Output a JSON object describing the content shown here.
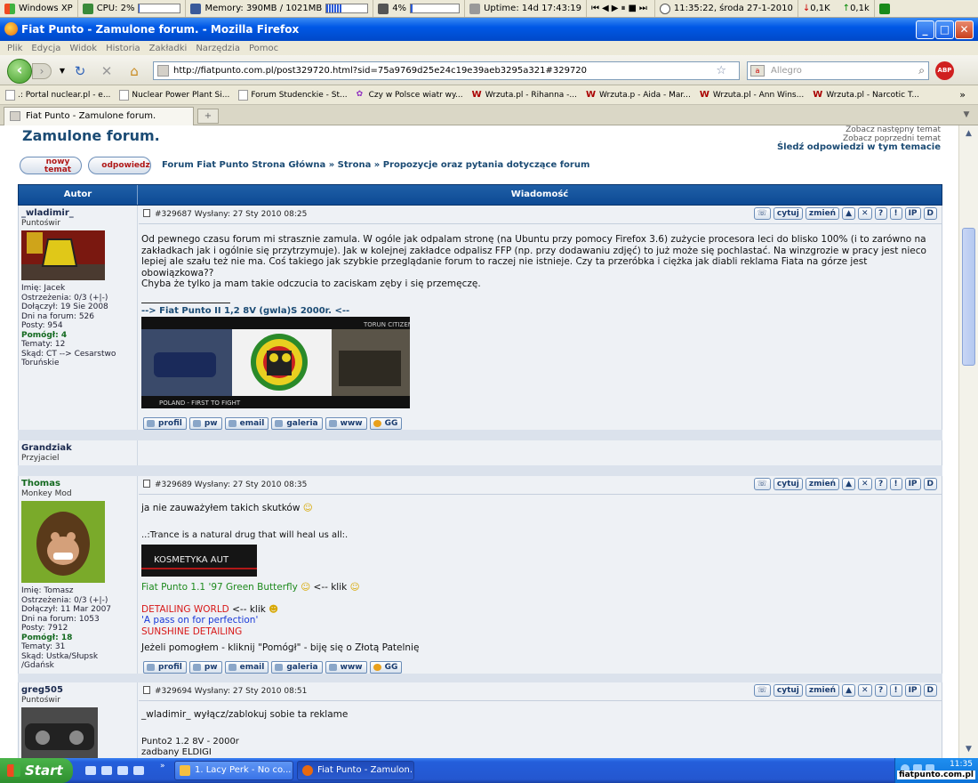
{
  "sysbar": {
    "os": "Windows XP",
    "cpu": "CPU: 2%",
    "cpu_level": 0.02,
    "memory": "Memory: 390MB / 1021MB",
    "memory_level": 0.38,
    "volume": "4%",
    "volume_level": 0.04,
    "uptime": "Uptime: 14d 17:43:19",
    "clock": "11:35:22, środa 27-1-2010",
    "down": "0,1K",
    "up": "0,1k"
  },
  "window": {
    "title": "Fiat Punto - Zamulone forum. - Mozilla Firefox",
    "minimize": "_",
    "maximize": "□",
    "close": "✕"
  },
  "menu": [
    "Plik",
    "Edycja",
    "Widok",
    "Historia",
    "Zakładki",
    "Narzędzia",
    "Pomoc"
  ],
  "nav": {
    "url": "http://fiatpunto.com.pl/post329720.html?sid=75a9769d25e24c19e39aeb3295a321#329720",
    "search_placeholder": "Allegro",
    "adblock": "ABP"
  },
  "bookmarks": [
    {
      "label": ".: Portal nuclear.pl - e...",
      "wrzuta": false
    },
    {
      "label": "Nuclear Power Plant Si...",
      "wrzuta": false
    },
    {
      "label": "Forum Studenckie - St...",
      "wrzuta": false
    },
    {
      "label": "Czy w Polsce wiatr wy...",
      "wrzuta": false
    },
    {
      "label": "Wrzuta.pl - Rihanna -...",
      "wrzuta": true
    },
    {
      "label": "Wrzuta.p - Aida - Mar...",
      "wrzuta": true
    },
    {
      "label": "Wrzuta.pl - Ann Wins...",
      "wrzuta": true
    },
    {
      "label": "Wrzuta.pl - Narcotic T...",
      "wrzuta": true
    }
  ],
  "tab": {
    "label": "Fiat Punto - Zamulone forum.",
    "new_tab": "+"
  },
  "page": {
    "title": "Zamulone forum.",
    "next_topic": "Zobacz następny temat",
    "prev_topic": "Zobacz poprzedni temat",
    "watch": "Śledź odpowiedzi w tym temacie",
    "new_topic_btn": "nowy temat",
    "reply_btn": "odpowiedz",
    "breadcrumb": "Forum Fiat Punto Strona Główna » Strona » Propozycje oraz pytania dotyczące forum",
    "col_author": "Autor",
    "col_message": "Wiadomość"
  },
  "post_buttons": {
    "quote": "cytuj",
    "edit": "zmień",
    "ip": "IP",
    "d": "D"
  },
  "footer_buttons": [
    "profil",
    "pw",
    "email",
    "galeria",
    "www",
    "GG"
  ],
  "posts": [
    {
      "author": "_wladimir_",
      "rank": "Puntoświr",
      "stats": [
        "Imię: Jacek",
        "Ostrzeżenia: 0/3 (+|-)",
        "Dołączył: 19 Sie 2008",
        "Dni na forum: 526",
        "Posty: 954",
        "Pomógł: 4",
        "Tematy: 12",
        "Skąd: CT --> Cesarstwo",
        "Toruńskie"
      ],
      "meta": "#329687 Wysłany: 27 Sty 2010 08:25",
      "body": "Od pewnego czasu forum mi strasznie zamula. W ogóle jak odpalam stronę (na Ubuntu przy pomocy Firefox 3.6) zużycie procesora leci do blisko 100% (i to zarówno na zakładkach jak i ogólnie się przytrzymuje). Jak w kolejnej zakładce odpalisz FFP (np. przy dodawaniu zdjęć) to już może się pochlastać. Na winzgrozie w pracy jest nieco lepiej ale szału też nie ma. Coś takiego jak szybkie przeglądanie forum to raczej nie istnieje. Czy ta przeróbka i ciężka jak diabli reklama Fiata na górze jest obowiązkowa??",
      "body2": "Chyba że tylko ja mam takie odczucia to zaciskam zęby i się przemęczę.",
      "sig": "--> Fiat Punto II 1,2 8V (gwla)S 2000r. <--",
      "banner_top": "TORUN CITIZEN",
      "banner_bottom": "POLAND - FIRST TO FIGHT"
    },
    {
      "author": "Grandziak",
      "rank": "Przyjaciel"
    },
    {
      "author": "Thomas",
      "rank": "Monkey Mod",
      "stats": [
        "Imię: Tomasz",
        "Ostrzeżenia: 0/3 (+|-)",
        "Dołączył: 11 Mar 2007",
        "Dni na forum: 1053",
        "Posty: 7912",
        "Pomógł: 18",
        "Tematy: 31",
        "Skąd: Ustka/Słupsk",
        "/Gdańsk"
      ],
      "meta": "#329689 Wysłany: 27 Sty 2010 08:35",
      "body": "ja nie zauważyłem takich skutków",
      "quote": "..:Trance is a natural drug that will heal us all:.",
      "banner": "KOSMETYKA AUT",
      "link1": "Fiat Punto 1.1 '97 Green Butterfly",
      "link1_after": "<-- klik",
      "red1": "DETAILING WORLD",
      "red1_after": "<-- klik",
      "blue1": "'A pass on for perfection'",
      "red2": "SUNSHINE DETAILING",
      "helped": "Jeżeli pomogłem - kliknij \"Pomógł\" - biję się o Złotą Patelnię"
    },
    {
      "author": "greg505",
      "rank": "Puntoświr",
      "meta": "#329694 Wysłany: 27 Sty 2010 08:51",
      "body": "_wladimir_ wyłącz/zablokuj sobie ta reklame",
      "sig1": "Punto2 1.2 8V - 2000r",
      "sig2": "zadbany ELDIGI"
    }
  ],
  "taskbar": {
    "start": "Start",
    "task1": "1. Lacy Perk - No co...",
    "task2": "Fiat Punto - Zamulon...",
    "time": "11:35",
    "watermark": "fiatpunto.com.pl"
  }
}
